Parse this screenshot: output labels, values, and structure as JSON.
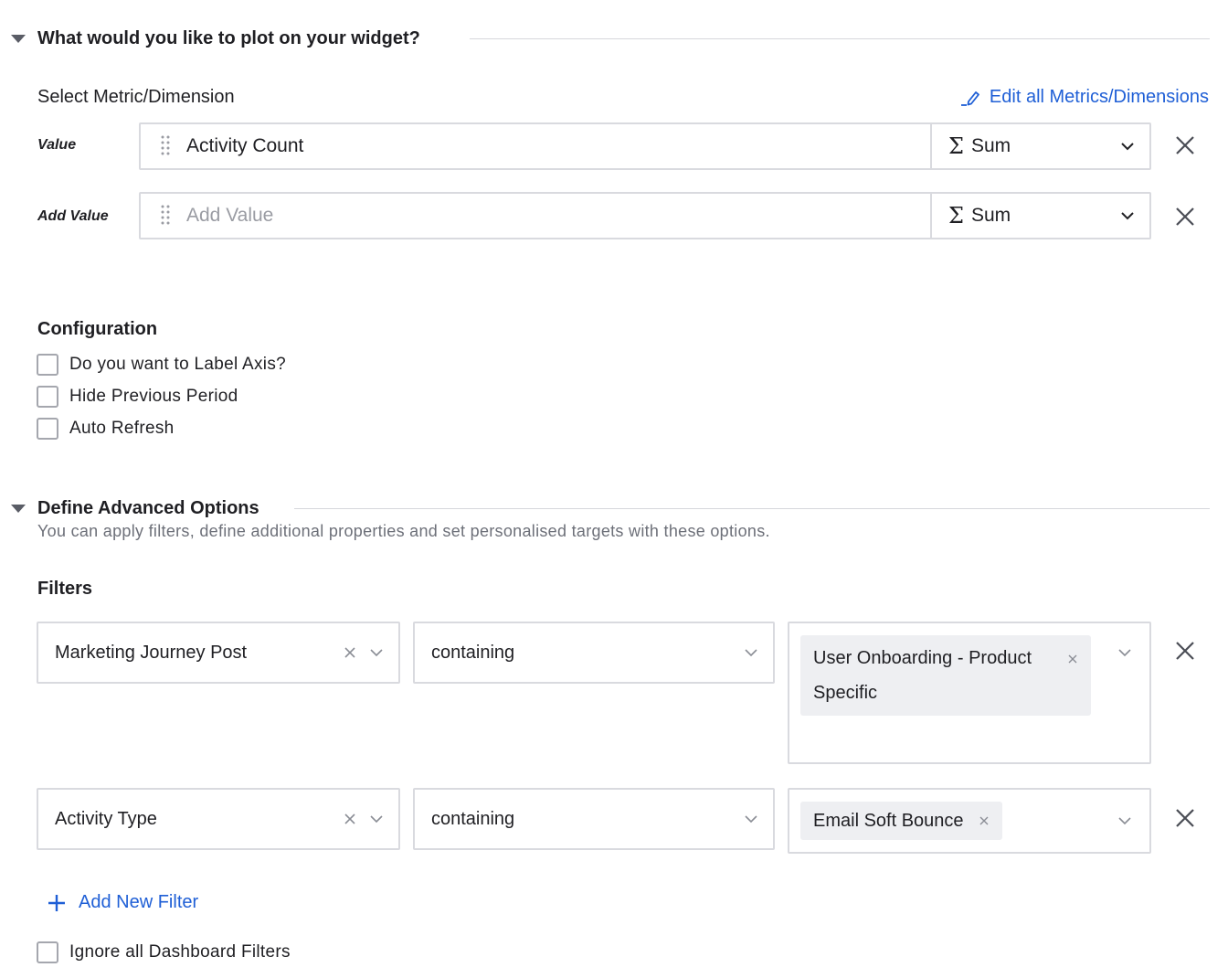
{
  "plot_section": {
    "title": "What would you like to plot on your widget?"
  },
  "metric": {
    "label": "Select Metric/Dimension",
    "edit_link": "Edit all Metrics/Dimensions",
    "rows": [
      {
        "label": "Value",
        "value": "Activity Count",
        "placeholder": "",
        "aggregation": "Sum"
      },
      {
        "label": "Add Value",
        "value": "",
        "placeholder": "Add Value",
        "aggregation": "Sum"
      }
    ]
  },
  "configuration": {
    "title": "Configuration",
    "options": [
      {
        "label": "Do you want to Label Axis?",
        "checked": false
      },
      {
        "label": "Hide Previous Period",
        "checked": false
      },
      {
        "label": "Auto Refresh",
        "checked": false
      }
    ]
  },
  "advanced": {
    "title": "Define Advanced Options",
    "description": "You can apply filters, define additional properties and set personalised targets with these options."
  },
  "filters": {
    "title": "Filters",
    "rows": [
      {
        "field": "Marketing Journey Post",
        "operator": "containing",
        "values": [
          "User Onboarding - Product Specific"
        ]
      },
      {
        "field": "Activity Type",
        "operator": "containing",
        "values": [
          "Email Soft Bounce"
        ]
      }
    ],
    "add_label": "Add New Filter",
    "ignore_dashboard_label": "Ignore all Dashboard Filters",
    "ignore_dashboard_checked": false
  },
  "colors": {
    "accent": "#1f5fd6",
    "border": "#d9dadf",
    "tag_bg": "#eeeff2",
    "text": "#1f1f23",
    "muted": "#6d7079"
  }
}
